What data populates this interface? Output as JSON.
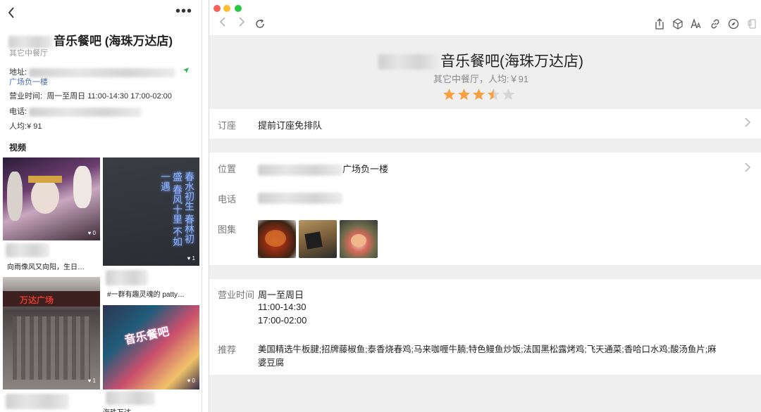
{
  "mobile": {
    "back_icon": "chevron-left-icon",
    "more_label": "•••",
    "title": "音乐餐吧 (海珠万达店)",
    "category": "其它中餐厅",
    "address_label": "地址:",
    "address_link": "广场负一楼",
    "hours_label": "营业时间:",
    "hours_value": "周一至周日 11:00-14:30 17:00-02:00",
    "phone_label": "电话:",
    "avg_label": "人均:",
    "avg_value": "¥ 91",
    "videos_heading": "视频",
    "videos": [
      {
        "caption": "向雨像风又向阳，生日…",
        "likes": "0"
      },
      {
        "caption": "",
        "likes": "1"
      },
      {
        "caption": "#一群有趣灵魂的 patty…",
        "likes": "1"
      },
      {
        "caption": "",
        "likes": "0"
      }
    ],
    "neon_text": "春水初生 春林初盛 春风十里 不如一遇",
    "sign_text": "音乐餐吧",
    "building_text": "万达广场",
    "bottom_caption": "海珠万达"
  },
  "browser": {
    "toolbar_icons": [
      "share-icon",
      "cube-icon",
      "text-size-icon",
      "link-icon",
      "compass-icon",
      "clipboard-icon"
    ],
    "title": "音乐餐吧(海珠万达店)",
    "subtitle": "其它中餐厅，人均:￥91",
    "rating": 3.5,
    "rows": {
      "booking_label": "订座",
      "booking_value": "提前订座免排队",
      "location_label": "位置",
      "location_value": "广场负一楼",
      "phone_label": "电话",
      "gallery_label": "图集",
      "hours_label": "营业时间",
      "hours_line1": "周一至周日",
      "hours_line2": "11:00-14:30",
      "hours_line3": "17:00-02:00",
      "recommend_label": "推荐",
      "recommend_line1": "美国精选牛板腱;招牌藤椒鱼;泰香烧春鸡;马来咖喱牛腩;特色鳗鱼炒饭;法国黑松露烤鸡;飞天通菜;香哈口水鸡;酸汤鱼片;麻",
      "recommend_line2": "婆豆腐"
    }
  },
  "colors": {
    "star": "#f5a142",
    "star_empty": "#d6d6d6",
    "link": "#4a6fb5",
    "traffic_red": "#fe5f57",
    "traffic_yellow": "#febc2e",
    "traffic_green": "#28c840"
  }
}
